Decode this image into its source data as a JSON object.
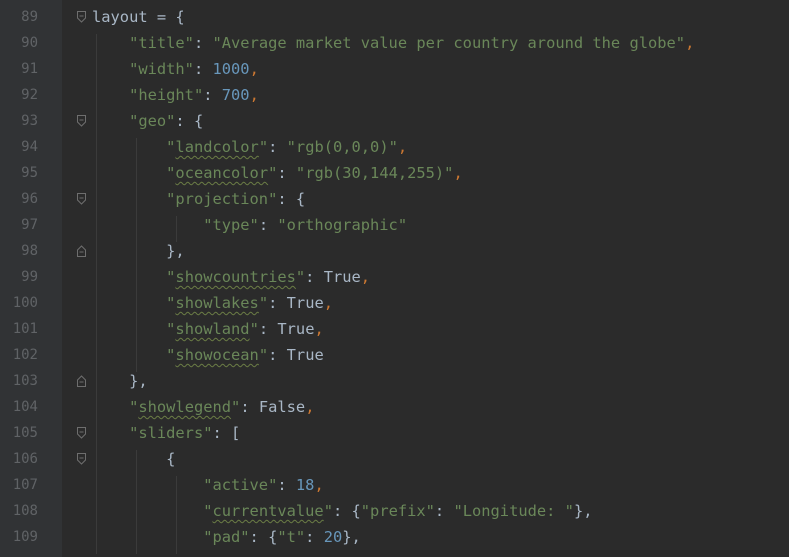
{
  "editor": {
    "lines": [
      {
        "num": "89",
        "fold": "open"
      },
      {
        "num": "90"
      },
      {
        "num": "91"
      },
      {
        "num": "92"
      },
      {
        "num": "93",
        "fold": "open"
      },
      {
        "num": "94"
      },
      {
        "num": "95"
      },
      {
        "num": "96",
        "fold": "open"
      },
      {
        "num": "97"
      },
      {
        "num": "98",
        "fold": "close"
      },
      {
        "num": "99"
      },
      {
        "num": "100"
      },
      {
        "num": "101"
      },
      {
        "num": "102"
      },
      {
        "num": "103",
        "fold": "close"
      },
      {
        "num": "104"
      },
      {
        "num": "105",
        "fold": "open"
      },
      {
        "num": "106",
        "fold": "open"
      },
      {
        "num": "107"
      },
      {
        "num": "108"
      },
      {
        "num": "109"
      }
    ],
    "tokens": {
      "l89_var": "layout",
      "l89_op": " = {",
      "l90_key": "\"title\"",
      "l90_colon": ": ",
      "l90_val": "\"Average market value per country around the globe\"",
      "l90_comma": ",",
      "l91_key": "\"width\"",
      "l91_colon": ": ",
      "l91_val": "1000",
      "l91_comma": ",",
      "l92_key": "\"height\"",
      "l92_colon": ": ",
      "l92_val": "700",
      "l92_comma": ",",
      "l93_key": "\"geo\"",
      "l93_colon": ": {",
      "l94_q1": "\"",
      "l94_key": "landcolor",
      "l94_q2": "\"",
      "l94_colon": ": ",
      "l94_val": "\"rgb(0,0,0)\"",
      "l94_comma": ",",
      "l95_q1": "\"",
      "l95_key": "oceancolor",
      "l95_q2": "\"",
      "l95_colon": ": ",
      "l95_val": "\"rgb(30,144,255)\"",
      "l95_comma": ",",
      "l96_key": "\"projection\"",
      "l96_colon": ": {",
      "l97_key": "\"type\"",
      "l97_colon": ": ",
      "l97_val": "\"orthographic\"",
      "l98_close": "},",
      "l99_q1": "\"",
      "l99_key": "showcountries",
      "l99_q2": "\"",
      "l99_colon": ": ",
      "l99_val": "True",
      "l99_comma": ",",
      "l100_q1": "\"",
      "l100_key": "showlakes",
      "l100_q2": "\"",
      "l100_colon": ": ",
      "l100_val": "True",
      "l100_comma": ",",
      "l101_q1": "\"",
      "l101_key": "showland",
      "l101_q2": "\"",
      "l101_colon": ": ",
      "l101_val": "True",
      "l101_comma": ",",
      "l102_q1": "\"",
      "l102_key": "showocean",
      "l102_q2": "\"",
      "l102_colon": ": ",
      "l102_val": "True",
      "l103_close": "},",
      "l104_q1": "\"",
      "l104_key": "showlegend",
      "l104_q2": "\"",
      "l104_colon": ": ",
      "l104_val": "False",
      "l104_comma": ",",
      "l105_key": "\"sliders\"",
      "l105_colon": ": [",
      "l106_open": "{",
      "l107_key": "\"active\"",
      "l107_colon": ": ",
      "l107_val": "18",
      "l107_comma": ",",
      "l108_q1": "\"",
      "l108_key": "currentvalue",
      "l108_q2": "\"",
      "l108_colon": ": {",
      "l108_k2": "\"prefix\"",
      "l108_c2": ": ",
      "l108_v2": "\"Longitude: \"",
      "l108_close": "},",
      "l109_key": "\"pad\"",
      "l109_colon": ": {",
      "l109_k2": "\"t\"",
      "l109_c2": ": ",
      "l109_v2": "20",
      "l109_close": "},"
    }
  }
}
